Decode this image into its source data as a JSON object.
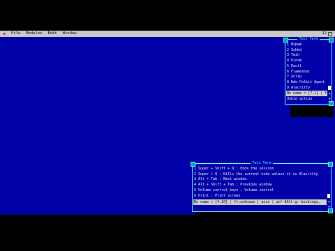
{
  "menubar": {
    "logo": "◆",
    "items": [
      "File",
      "Modules",
      "Edit",
      "Window"
    ],
    "clock": "12"
  },
  "window_launcher": {
    "title": "Twin Term",
    "items": [
      "1 Bspwm",
      "2 Sxhkd",
      "3 Twin",
      "4 Picom",
      "5 Pactl",
      "6 Flameshot",
      "7 Xclip",
      "8 Kde Polkit Agent",
      "9 Alacritty"
    ],
    "status": "No name < [7,1] | ft",
    "action": "Unbid action"
  },
  "window_keys": {
    "title": "Twin Term",
    "items": [
      "1 Super + Shift + Q : Ends the session",
      "2 Super + Q : Kills the current node unless it is Alacritty",
      "3 Alt + Tab : Next window",
      "4 Alt + Shift + Tab : Previous window",
      "5 Volume control keys : Volume control",
      "6 Print : Print screen"
    ],
    "status": "No name < [4,10] | ft:unknown | unix | utf-8Alt-g: bindings,"
  },
  "colors": {
    "desktop": "#0000a8",
    "border": "#55ffff",
    "menubar": "#c9c9c9"
  }
}
